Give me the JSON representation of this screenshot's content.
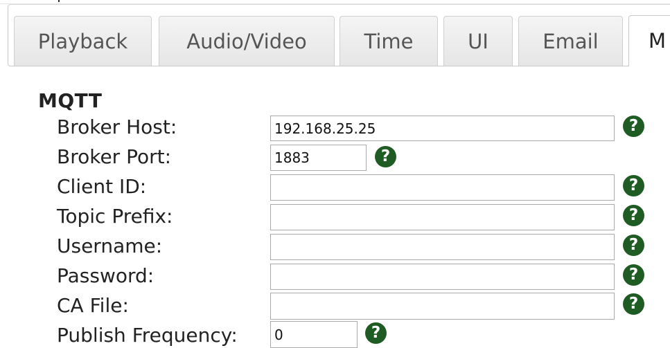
{
  "tabs": [
    {
      "label": "Playback",
      "active": false
    },
    {
      "label": "Audio/Video",
      "active": false
    },
    {
      "label": "Time",
      "active": false
    },
    {
      "label": "UI",
      "active": false
    },
    {
      "label": "Email",
      "active": false
    },
    {
      "label": "M",
      "active": true
    }
  ],
  "section": {
    "title": "MQTT"
  },
  "fields": {
    "broker_host": {
      "label": "Broker Host:",
      "value": "192.168.25.25"
    },
    "broker_port": {
      "label": "Broker Port:",
      "value": "1883"
    },
    "client_id": {
      "label": "Client ID:",
      "value": ""
    },
    "topic_prefix": {
      "label": "Topic Prefix:",
      "value": ""
    },
    "username": {
      "label": "Username:",
      "value": ""
    },
    "password": {
      "label": "Password:",
      "value": ""
    },
    "ca_file": {
      "label": "CA File:",
      "value": ""
    },
    "publish_frequency": {
      "label": "Publish Frequency:",
      "value": "0"
    }
  },
  "help_icon": {
    "glyph": "?",
    "color": "#1e5c24"
  }
}
